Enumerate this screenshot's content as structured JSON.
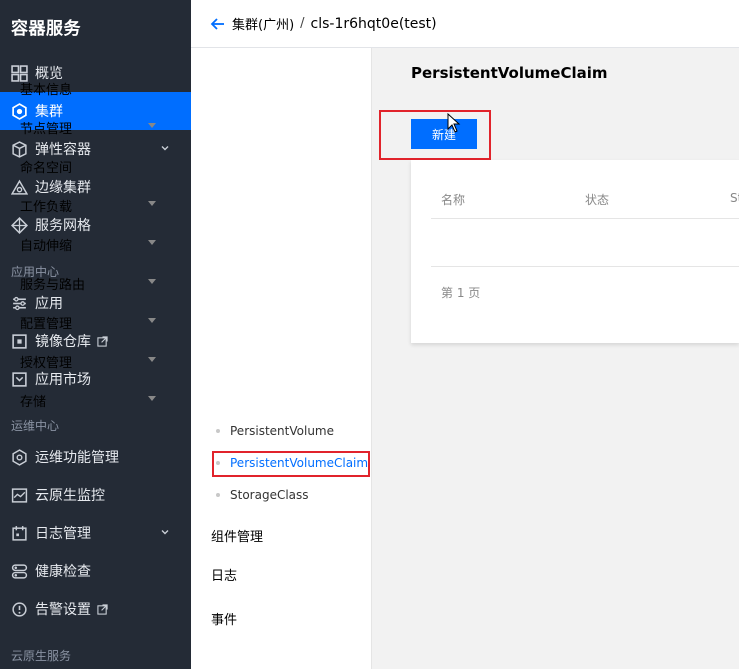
{
  "sidebar": {
    "brand": "容器服务",
    "items": [
      {
        "label": "概览",
        "icon": "grid-icon"
      },
      {
        "label": "集群",
        "icon": "cluster-icon",
        "active": true
      },
      {
        "label": "弹性容器",
        "icon": "cube-icon",
        "expandable": true
      },
      {
        "label": "边缘集群",
        "icon": "edge-icon"
      },
      {
        "label": "服务网格",
        "icon": "mesh-icon"
      }
    ],
    "section_app": "应用中心",
    "app_items": [
      {
        "label": "应用",
        "icon": "app-icon"
      },
      {
        "label": "镜像仓库",
        "icon": "image-icon",
        "external": true
      },
      {
        "label": "应用市场",
        "icon": "market-icon"
      }
    ],
    "section_ops": "运维中心",
    "ops_items": [
      {
        "label": "运维功能管理",
        "icon": "ops-icon"
      },
      {
        "label": "云原生监控",
        "icon": "monitor-icon"
      },
      {
        "label": "日志管理",
        "icon": "log-icon",
        "expandable": true
      },
      {
        "label": "健康检查",
        "icon": "health-icon"
      },
      {
        "label": "告警设置",
        "icon": "alarm-icon",
        "external": true
      }
    ],
    "section_cloud": "云原生服务"
  },
  "topbar": {
    "parent": "集群(广州)",
    "separator": "/",
    "current": "cls-1r6hqt0e(test)"
  },
  "submenu": {
    "items": [
      {
        "label": "基本信息",
        "caret": false
      },
      {
        "label": "节点管理",
        "caret": true
      },
      {
        "label": "命名空间",
        "caret": false
      },
      {
        "label": "工作负载",
        "caret": true
      },
      {
        "label": "自动伸缩",
        "caret": true
      },
      {
        "label": "服务与路由",
        "caret": true
      },
      {
        "label": "配置管理",
        "caret": true
      },
      {
        "label": "授权管理",
        "caret": true
      },
      {
        "label": "存储",
        "caret": true
      }
    ],
    "storage_children": [
      {
        "label": "PersistentVolume"
      },
      {
        "label": "PersistentVolumeClaim",
        "active": true
      },
      {
        "label": "StorageClass"
      }
    ],
    "tail_items": [
      {
        "label": "组件管理"
      },
      {
        "label": "日志"
      },
      {
        "label": "事件"
      }
    ]
  },
  "content": {
    "title": "PersistentVolumeClaim",
    "create_label": "新建",
    "columns": [
      "名称",
      "状态",
      "St"
    ],
    "pager": "第 1 页"
  },
  "colors": {
    "sidebar_bg": "#242b36",
    "accent": "#006eff",
    "highlight": "#e1232b"
  }
}
